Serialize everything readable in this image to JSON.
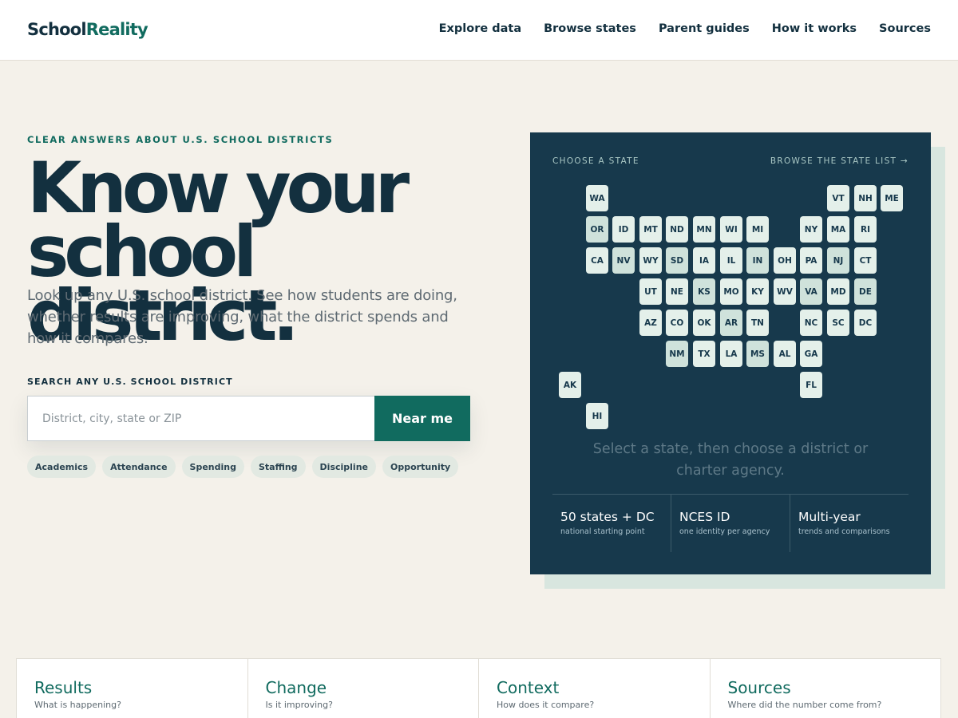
{
  "header": {
    "logo_main": "School",
    "logo_accent": "Reality",
    "nav": [
      "Explore data",
      "Browse states",
      "Parent guides",
      "How it works",
      "Sources"
    ]
  },
  "hero": {
    "eyebrow": "CLEAR ANSWERS ABOUT U.S. SCHOOL DISTRICTS",
    "title_line1": "Know your",
    "title_line2": "school district.",
    "subtitle": "Look up any U.S. school district. See how students are doing, whether results are improving, what the district spends and how it compares."
  },
  "search": {
    "label": "SEARCH ANY U.S. SCHOOL DISTRICT",
    "placeholder": "District, city, state or ZIP",
    "value": "",
    "button": "Near me",
    "chips": [
      "Academics",
      "Attendance",
      "Spending",
      "Staffing",
      "Discipline",
      "Opportunity"
    ]
  },
  "map": {
    "label": "CHOOSE A STATE",
    "link": "BROWSE THE STATE LIST →",
    "hint": "Select a state, then choose a district or charter agency.",
    "states": [
      {
        "code": "WA",
        "col": 1,
        "row": 0
      },
      {
        "code": "VT",
        "col": 10,
        "row": 0
      },
      {
        "code": "NH",
        "col": 11,
        "row": 0
      },
      {
        "code": "ME",
        "col": 12,
        "row": 0
      },
      {
        "code": "OR",
        "col": 1,
        "row": 1,
        "tone": "dark"
      },
      {
        "code": "ID",
        "col": 2,
        "row": 1
      },
      {
        "code": "MT",
        "col": 3,
        "row": 1
      },
      {
        "code": "ND",
        "col": 4,
        "row": 1
      },
      {
        "code": "MN",
        "col": 5,
        "row": 1
      },
      {
        "code": "WI",
        "col": 6,
        "row": 1
      },
      {
        "code": "MI",
        "col": 7,
        "row": 1
      },
      {
        "code": "NY",
        "col": 9,
        "row": 1
      },
      {
        "code": "MA",
        "col": 10,
        "row": 1
      },
      {
        "code": "RI",
        "col": 11,
        "row": 1
      },
      {
        "code": "CA",
        "col": 1,
        "row": 2
      },
      {
        "code": "NV",
        "col": 2,
        "row": 2,
        "tone": "dark"
      },
      {
        "code": "WY",
        "col": 3,
        "row": 2
      },
      {
        "code": "SD",
        "col": 4,
        "row": 2,
        "tone": "dark"
      },
      {
        "code": "IA",
        "col": 5,
        "row": 2
      },
      {
        "code": "IL",
        "col": 6,
        "row": 2
      },
      {
        "code": "IN",
        "col": 7,
        "row": 2,
        "tone": "dark"
      },
      {
        "code": "OH",
        "col": 8,
        "row": 2
      },
      {
        "code": "PA",
        "col": 9,
        "row": 2
      },
      {
        "code": "NJ",
        "col": 10,
        "row": 2,
        "tone": "dark"
      },
      {
        "code": "CT",
        "col": 11,
        "row": 2
      },
      {
        "code": "UT",
        "col": 3,
        "row": 3
      },
      {
        "code": "NE",
        "col": 4,
        "row": 3
      },
      {
        "code": "KS",
        "col": 5,
        "row": 3,
        "tone": "dark"
      },
      {
        "code": "MO",
        "col": 6,
        "row": 3
      },
      {
        "code": "KY",
        "col": 7,
        "row": 3
      },
      {
        "code": "WV",
        "col": 8,
        "row": 3
      },
      {
        "code": "VA",
        "col": 9,
        "row": 3,
        "tone": "dark"
      },
      {
        "code": "MD",
        "col": 10,
        "row": 3
      },
      {
        "code": "DE",
        "col": 11,
        "row": 3,
        "tone": "dark"
      },
      {
        "code": "AZ",
        "col": 3,
        "row": 4
      },
      {
        "code": "CO",
        "col": 4,
        "row": 4
      },
      {
        "code": "OK",
        "col": 5,
        "row": 4
      },
      {
        "code": "AR",
        "col": 6,
        "row": 4,
        "tone": "dark"
      },
      {
        "code": "TN",
        "col": 7,
        "row": 4
      },
      {
        "code": "NC",
        "col": 9,
        "row": 4
      },
      {
        "code": "SC",
        "col": 10,
        "row": 4
      },
      {
        "code": "DC",
        "col": 11,
        "row": 4
      },
      {
        "code": "NM",
        "col": 4,
        "row": 5,
        "tone": "dark"
      },
      {
        "code": "TX",
        "col": 5,
        "row": 5
      },
      {
        "code": "LA",
        "col": 6,
        "row": 5
      },
      {
        "code": "MS",
        "col": 7,
        "row": 5,
        "tone": "dark"
      },
      {
        "code": "AL",
        "col": 8,
        "row": 5
      },
      {
        "code": "GA",
        "col": 9,
        "row": 5
      },
      {
        "code": "AK",
        "col": 0,
        "row": 6
      },
      {
        "code": "FL",
        "col": 9,
        "row": 6
      },
      {
        "code": "HI",
        "col": 1,
        "row": 7
      }
    ],
    "stats": [
      {
        "value": "50 states + DC",
        "caption": "national starting point"
      },
      {
        "value": "NCES ID",
        "caption": "one identity per agency"
      },
      {
        "value": "Multi-year",
        "caption": "trends and comparisons"
      }
    ]
  },
  "cards": [
    {
      "title": "Results",
      "subtitle": "What is happening?"
    },
    {
      "title": "Change",
      "subtitle": "Is it improving?"
    },
    {
      "title": "Context",
      "subtitle": "How does it compare?"
    },
    {
      "title": "Sources",
      "subtitle": "Where did the number come from?"
    }
  ],
  "colors": {
    "accent": "#116b5f",
    "ink": "#13303f",
    "panel": "#17394c",
    "background": "#f4f1ea"
  }
}
